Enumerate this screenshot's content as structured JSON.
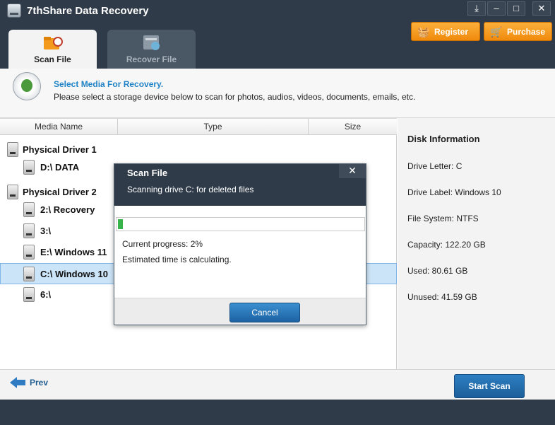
{
  "app": {
    "title": "7thShare Data Recovery"
  },
  "window_controls": [
    "⤓",
    "–",
    "□",
    "✕"
  ],
  "header": {
    "register_label": "Register",
    "purchase_label": "Purchase"
  },
  "tabs": [
    {
      "label": "Scan File",
      "active": true
    },
    {
      "label": "Recover File",
      "active": false
    }
  ],
  "info": {
    "title": "Select Media For Recovery.",
    "description": "Please select a storage device below to scan for photos, audios, videos, documents, emails, etc."
  },
  "table": {
    "columns": [
      "Media Name",
      "Type",
      "Size"
    ],
    "rows": [
      {
        "label": "Physical Driver 1",
        "kind": "physical"
      },
      {
        "label": "D:\\ DATA",
        "kind": "partition"
      },
      {
        "label": "Physical Driver 2",
        "kind": "physical"
      },
      {
        "label": "2:\\ Recovery",
        "kind": "partition"
      },
      {
        "label": "3:\\",
        "kind": "partition"
      },
      {
        "label": "E:\\ Windows 11",
        "kind": "partition"
      },
      {
        "label": "C:\\ Windows 10",
        "kind": "partition",
        "selected": true
      },
      {
        "label": "6:\\",
        "kind": "partition"
      }
    ]
  },
  "disk_info": {
    "title": "Disk Information",
    "drive_letter": "Drive Letter: C",
    "drive_label": "Drive Label: Windows 10",
    "file_system": "File System: NTFS",
    "capacity": "Capacity: 122.20 GB",
    "used": "Used: 80.61 GB",
    "unused": "Unused: 41.59 GB"
  },
  "footer": {
    "prev_label": "Prev",
    "start_label": "Start Scan"
  },
  "modal": {
    "title": "Scan File",
    "subtitle": "Scanning drive C: for deleted files",
    "close": "✕",
    "progress_fraction": 0.02,
    "progress_text": "Current progress: 2%",
    "estimate_text": "Estimated time is calculating.",
    "cancel_label": "Cancel"
  },
  "colors": {
    "accent": "#1f83c5",
    "orange": "#f7a12a",
    "dark": "#2f3b48",
    "progress": "#37b34a",
    "selection": "#cce4f7"
  }
}
